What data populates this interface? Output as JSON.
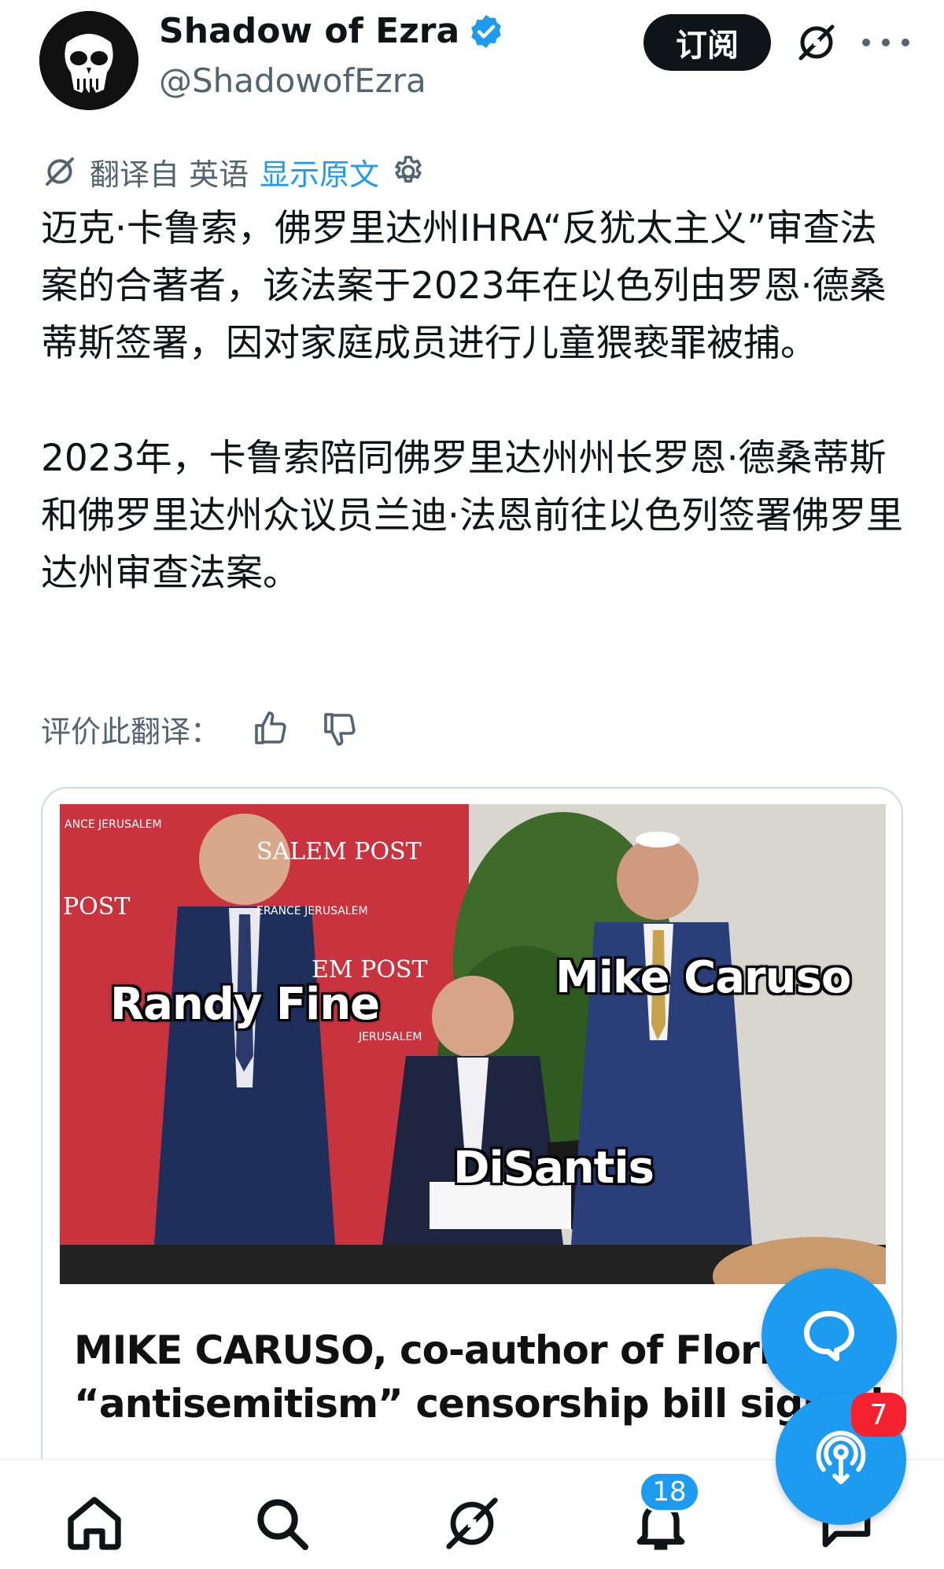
{
  "author": {
    "display_name": "Shadow of Ezra",
    "handle": "@ShadowofEzra",
    "avatar_icon": "punisher-skull-icon",
    "verified": true
  },
  "header": {
    "subscribe_label": "订阅",
    "grok_icon": "grok-icon",
    "more_icon": "more-icon"
  },
  "translation": {
    "prefix": "翻译自 英语",
    "show_original": "显示原文",
    "settings_icon": "gear-icon"
  },
  "tweet": {
    "paragraph_1": "迈克·卡鲁索，佛罗里达州IHRA“反犹太主义”审查法案的合著者，该法案于2023年在以色列由罗恩·德桑蒂斯签署，因对家庭成员进行儿童猥亵罪被捕。",
    "paragraph_2": "2023年，卡鲁索陪同佛罗里达州州长罗恩·德桑蒂斯和佛罗里达州众议员兰迪·法恩前往以色列签署佛罗里达州审查法案。"
  },
  "rating": {
    "label": "评价此翻译：",
    "thumbs_up_icon": "thumbs-up-icon",
    "thumbs_down_icon": "thumbs-down-icon"
  },
  "media": {
    "labels": {
      "left": "Randy Fine",
      "right": "Mike Caruso",
      "center": "DiSantis"
    },
    "banner_texts": [
      "ANCE JERUSALEM",
      "SALEM POST",
      "POST",
      "ERANCE JERUSALEM",
      "EM POST",
      "JERUSALEM"
    ],
    "caption_line_1": "MIKE CARUSO, co-author of Florida’s",
    "caption_line_2": "“antisemitism” censorship bill signed"
  },
  "fab": {
    "reply_icon": "reply-bubble-icon",
    "spaces_icon": "spaces-podcast-icon",
    "spaces_badge": "7"
  },
  "bottom_nav": {
    "items": [
      "home-icon",
      "search-icon",
      "grok-icon",
      "notifications-icon",
      "messages-icon"
    ],
    "notifications_badge": "18"
  },
  "colors": {
    "accent": "#1d9bf0",
    "text": "#0f1419",
    "secondary_text": "#536471",
    "badge_red": "#f4212e"
  }
}
